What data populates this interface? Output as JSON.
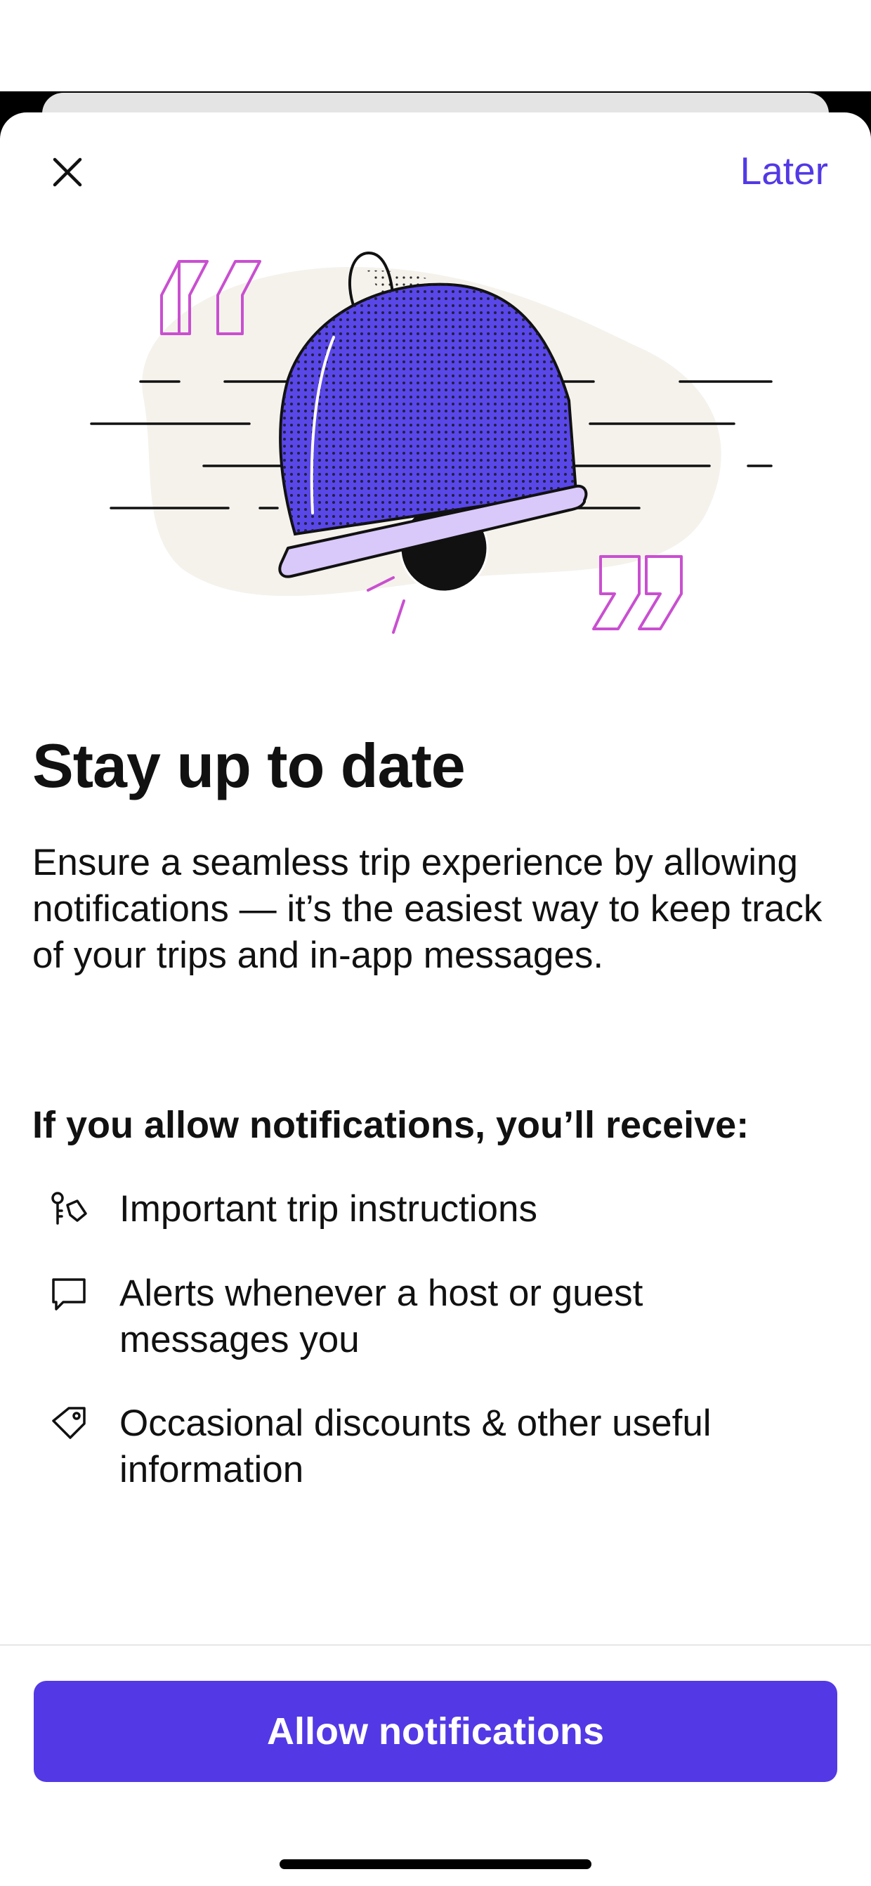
{
  "header": {
    "later_label": "Later"
  },
  "content": {
    "title": "Stay up to date",
    "description": "Ensure a seamless trip experience by allowing notifications — it’s the easiest way to keep track of your trips and in-app messages.",
    "benefits_heading": "If you allow notifications, you’ll receive:",
    "benefits": [
      {
        "icon": "key-icon",
        "label": "Important trip instructions"
      },
      {
        "icon": "chat-bubble-icon",
        "label": "Alerts whenever a host or guest messages you"
      },
      {
        "icon": "tag-icon",
        "label": "Occasional discounts & other useful information"
      }
    ]
  },
  "footer": {
    "cta_label": "Allow notifications"
  },
  "colors": {
    "accent": "#5239e5",
    "bell_blue": "#5a47e8",
    "bell_rim": "#d9c9fb",
    "quote_pink": "#c94fd0",
    "blob": "#f5f2ec"
  }
}
